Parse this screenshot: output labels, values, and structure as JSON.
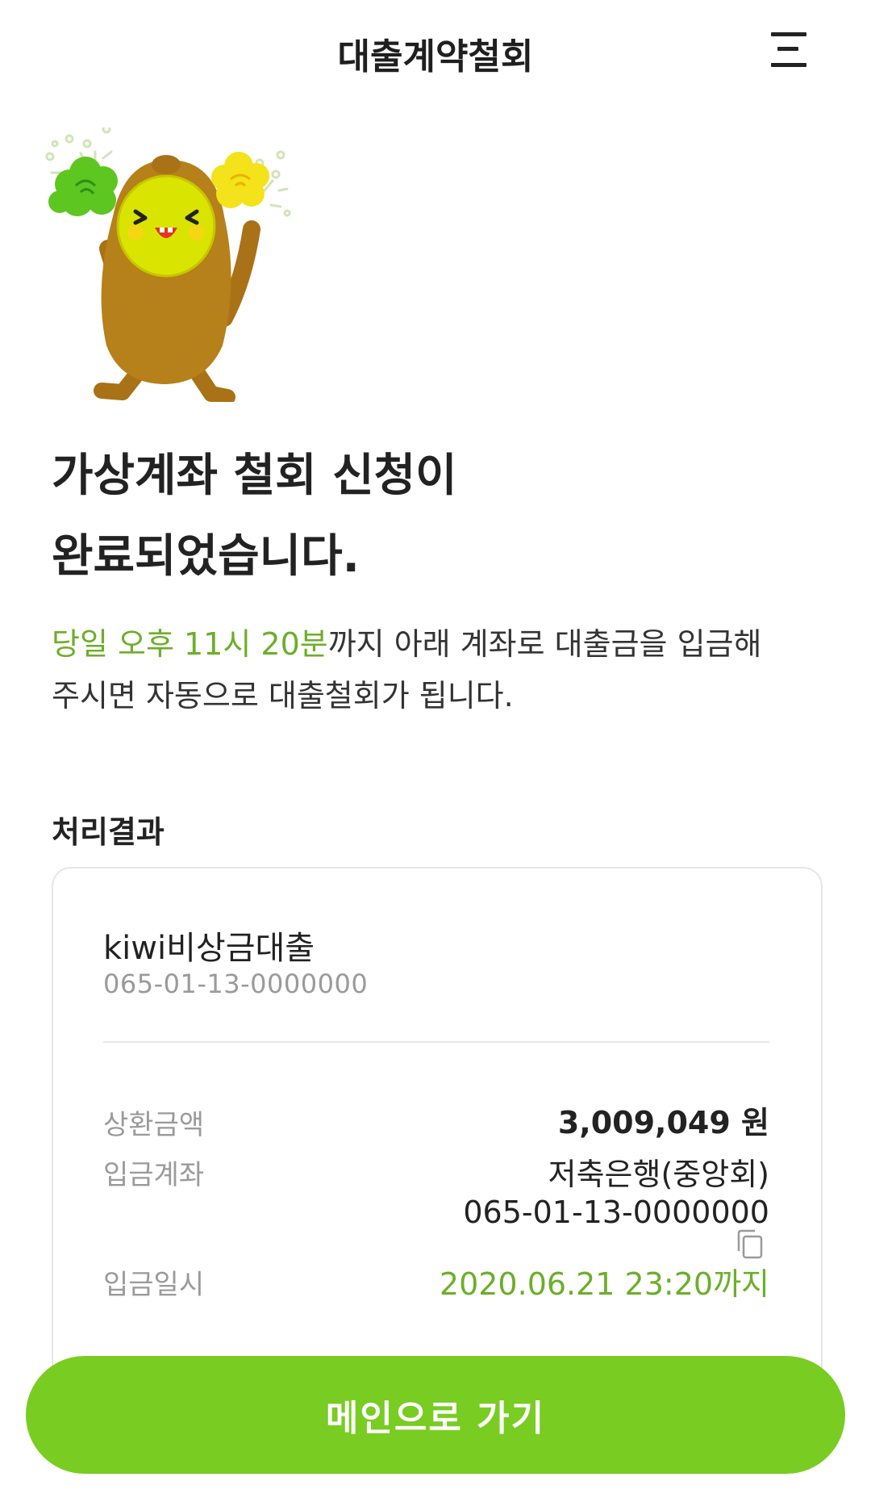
{
  "header": {
    "title": "대출계약철회",
    "menu_icon": "hamburger-menu-icon"
  },
  "mascot": {
    "icon": "cheering-kiwi-mascot-illustration",
    "colors": {
      "body": "#b6801a",
      "face": "#d9e400",
      "pompom_left": "#5ec621",
      "pompom_right": "#f4e21a"
    }
  },
  "headline": {
    "line1": "가상계좌 철회 신청이",
    "line2": "완료되었습니다."
  },
  "description": {
    "highlight": "당일 오후 11시 20분",
    "rest_line1": "까지 아래 계좌로 대출금을 입금해",
    "line2": "주시면 자동으로 대출철회가 됩니다."
  },
  "result": {
    "section_title": "처리결과",
    "product_name": "kiwi비상금대출",
    "product_account": "065-01-13-0000000",
    "rows": {
      "amount_label": "상환금액",
      "amount_value": "3,009,049 원",
      "account_label": "입금계좌",
      "bank_name": "저축은행(중앙회)",
      "deposit_account": "065-01-13-0000000",
      "copy_icon": "copy-icon",
      "deadline_label": "입금일시",
      "deadline_value": "2020.06.21 23:20까지"
    }
  },
  "main_button": {
    "label": "메인으로 가기"
  },
  "colors": {
    "accent": "#79cc22",
    "highlight_text": "#6cae2a",
    "muted_text": "#9a9a9a"
  }
}
